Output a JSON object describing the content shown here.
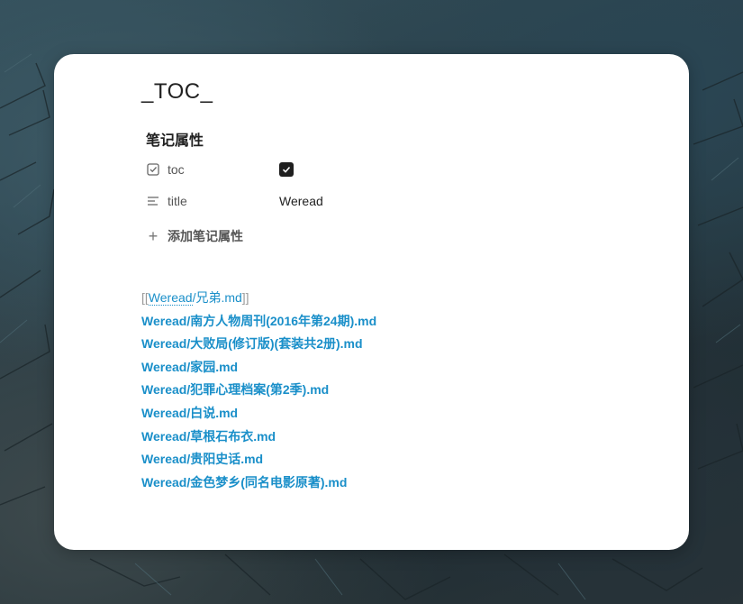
{
  "note": {
    "title": "_TOC_",
    "properties_heading": "笔记属性",
    "properties": [
      {
        "name": "toc",
        "icon": "checkbox-icon",
        "type": "checkbox",
        "checked": true
      },
      {
        "name": "title",
        "icon": "text-lines-icon",
        "type": "text",
        "value": "Weread"
      }
    ],
    "add_property_label": "添加笔记属性",
    "links": {
      "first_open_bracket": "[[",
      "first_link_text": "Weread",
      "first_rest": "/兄弟.md",
      "first_close_bracket": "]]",
      "items": [
        "Weread/南方人物周刊(2016年第24期).md",
        "Weread/大败局(修订版)(套装共2册).md",
        "Weread/家园.md",
        "Weread/犯罪心理档案(第2季).md",
        "Weread/白说.md",
        "Weread/草根石布衣.md",
        "Weread/贵阳史话.md",
        "Weread/金色梦乡(同名电影原著).md"
      ]
    }
  },
  "colors": {
    "link": "#1a8fc9",
    "card_background": "#ffffff",
    "checkbox_fill": "#1f1f1f"
  }
}
